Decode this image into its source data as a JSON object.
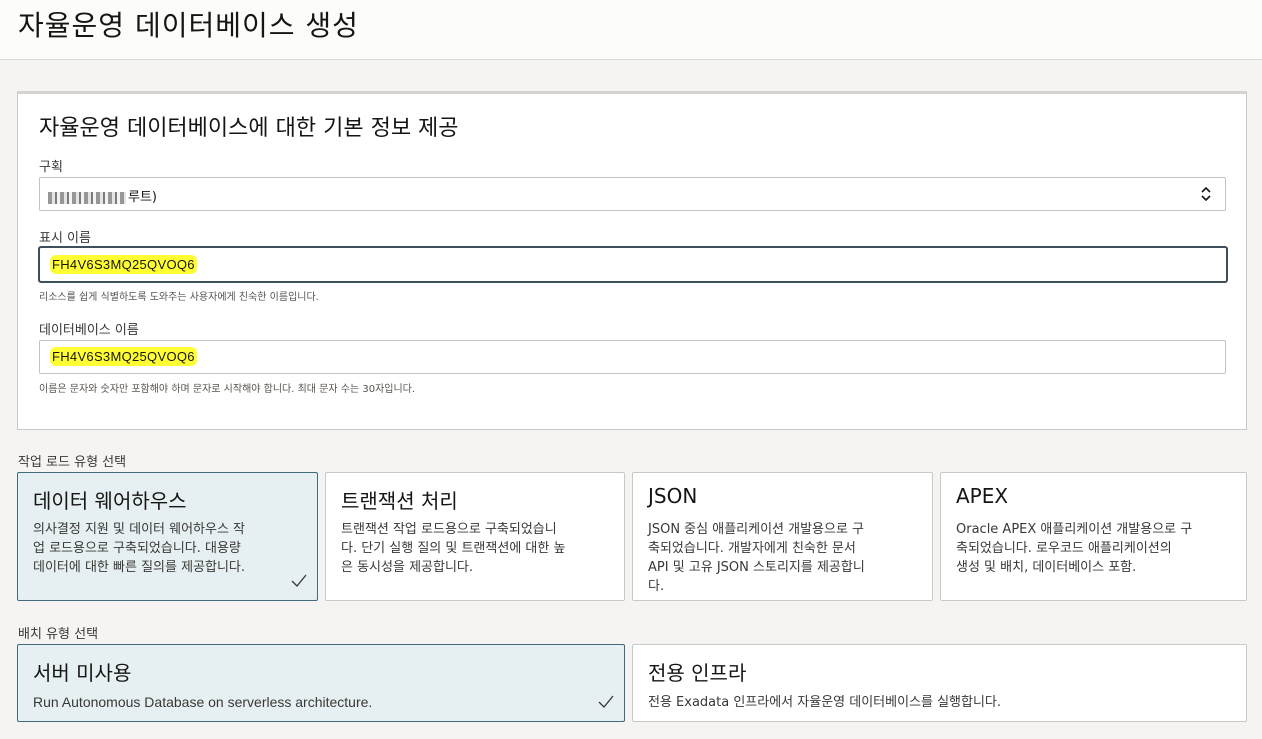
{
  "page": {
    "title": "자율운영 데이터베이스 생성"
  },
  "basic_info": {
    "title": "자율운영 데이터베이스에 대한 기본 정보 제공",
    "compartment": {
      "label": "구획",
      "value_suffix": "루트)"
    },
    "display_name": {
      "label": "표시 이름",
      "value": "FH4V6S3MQ25QVOQ6",
      "hint": "리소스를 쉽게 식별하도록 도와주는 사용자에게 친숙한 이름입니다."
    },
    "database_name": {
      "label": "데이터베이스 이름",
      "value": "FH4V6S3MQ25QVOQ6",
      "hint": "이름은 문자와 숫자만 포함해야 하며 문자로 시작해야 합니다. 최대 문자 수는 30자입니다."
    }
  },
  "workload": {
    "label": "작업 로드 유형 선택",
    "options": [
      {
        "title": "데이터 웨어하우스",
        "desc": "의사결정 지원 및 데이터 웨어하우스 작\n업 로드용으로 구축되었습니다. 대용량\n데이터에 대한 빠른 질의를 제공합니다.",
        "selected": true
      },
      {
        "title": "트랜잭션 처리",
        "desc": "트랜잭션 작업 로드용으로 구축되었습니\n다. 단기 실행 질의 및 트랜잭션에 대한 높\n은 동시성을 제공합니다.",
        "selected": false
      },
      {
        "title": "JSON",
        "desc": "JSON 중심 애플리케이션 개발용으로 구\n축되었습니다. 개발자에게 친숙한 문서\nAPI 및 고유 JSON 스토리지를 제공합니\n다.",
        "selected": false
      },
      {
        "title": "APEX",
        "desc": "Oracle APEX 애플리케이션 개발용으로 구\n축되었습니다. 로우코드 애플리케이션의\n생성 및 배치, 데이터베이스 포함.",
        "selected": false
      }
    ]
  },
  "deployment": {
    "label": "배치 유형 선택",
    "options": [
      {
        "title": "서버 미사용",
        "desc": "Run Autonomous Database on serverless architecture.",
        "selected": true
      },
      {
        "title": "전용 인프라",
        "desc": "전용 Exadata 인프라에서 자율운영 데이터베이스를 실행합니다.",
        "selected": false
      }
    ]
  },
  "colors": {
    "selected_bg": "#e6f0f2",
    "selected_border": "#3f6b7c",
    "highlight": "#ffff33"
  }
}
